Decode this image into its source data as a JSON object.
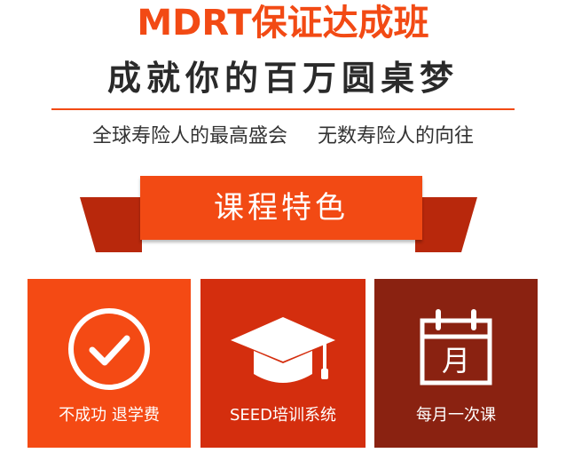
{
  "header": {
    "title": "MDRT保证达成班",
    "subtitle": "成就你的百万圆桌梦",
    "tagline_left": "全球寿险人的最高盛会",
    "tagline_right": "无数寿险人的向往"
  },
  "section": {
    "heading": "课程特色"
  },
  "features": [
    {
      "label": "不成功 退学费",
      "icon": "checkmark-circle-icon"
    },
    {
      "label": "SEED培训系统",
      "icon": "graduation-cap-icon"
    },
    {
      "label": "每月一次课",
      "icon": "calendar-icon",
      "icon_text": "月"
    }
  ],
  "colors": {
    "accent": "#f24a14",
    "feature_1": "#f44a14",
    "feature_2": "#d42e0e",
    "feature_3": "#8a2211",
    "ribbon_side": "#b8280c"
  }
}
